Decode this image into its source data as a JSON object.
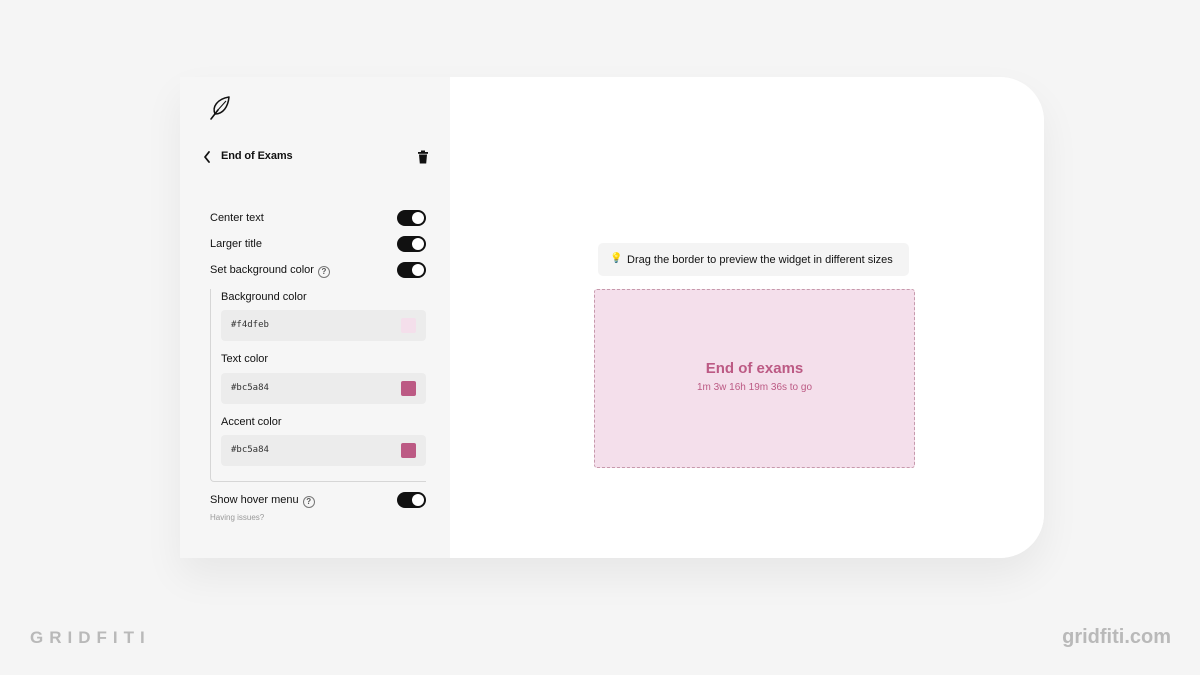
{
  "sidebar": {
    "title": "End of Exams",
    "toggles": {
      "center_text": {
        "label": "Center text",
        "on": true
      },
      "larger_title": {
        "label": "Larger title",
        "on": true
      },
      "set_background": {
        "label": "Set background color",
        "on": true
      },
      "show_hover_menu": {
        "label": "Show hover menu",
        "on": true
      }
    },
    "help_glyph": "?",
    "colors": {
      "background": {
        "label": "Background color",
        "value": "#f4dfeb"
      },
      "text": {
        "label": "Text color",
        "value": "#bc5a84"
      },
      "accent": {
        "label": "Accent color",
        "value": "#bc5a84"
      }
    },
    "issues_link": "Having issues?"
  },
  "preview": {
    "tip_icon": "lightbulb-icon",
    "tip_glyph": "💡",
    "tip": "Drag the border to preview the widget in different sizes",
    "widget": {
      "title": "End of exams",
      "countdown": "1m 3w 16h 19m 36s to go"
    }
  },
  "branding": {
    "left": "GRIDFITI",
    "right": "gridfiti.com"
  }
}
